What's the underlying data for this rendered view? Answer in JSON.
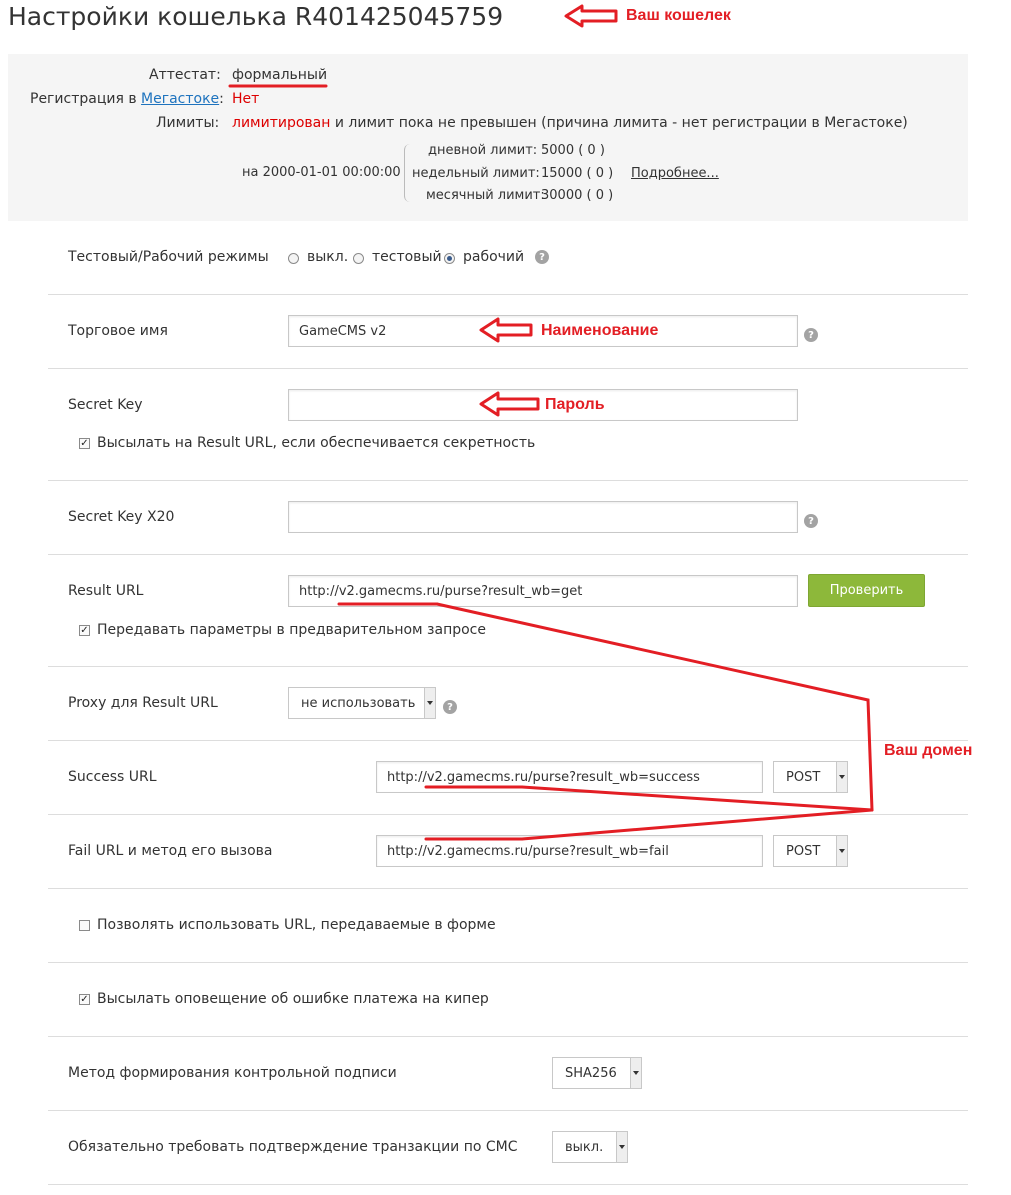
{
  "page_title": "Настройки кошелька R401425045759",
  "info": {
    "attestat_label": "Аттестат:",
    "attestat_value": "формальный",
    "registration_label": "Регистрация в",
    "registration_link": "Мегастоке",
    "registration_colon": ":",
    "registration_value": "Нет",
    "limits_label": "Лимиты:",
    "limits_status": "лимитирован",
    "limits_rest": " и лимит пока не превышен (причина лимита - нет регистрации в Мегастоке)",
    "date": "на 2000-01-01 00:00:00",
    "daily_label": "дневной лимит:",
    "daily_value": "5000 ( 0 )",
    "weekly_label": "недельный лимит:",
    "weekly_value": "15000 ( 0 )",
    "monthly_label": "месячный лимит:",
    "monthly_value": "30000 ( 0 )",
    "more_link": "Подробнее..."
  },
  "mode": {
    "label": "Тестовый/Рабочий режимы",
    "options": [
      "выкл.",
      "тестовый",
      "рабочий"
    ],
    "selected": "рабочий"
  },
  "trade_name": {
    "label": "Торговое имя",
    "value": "GameCMS v2"
  },
  "secret_key": {
    "label": "Secret Key",
    "value": "",
    "checkbox_label": "Высылать на Result URL, если обеспечивается секретность",
    "checked": true
  },
  "secret_key_x20": {
    "label": "Secret Key X20",
    "value": ""
  },
  "result_url": {
    "label": "Result URL",
    "value": "http://v2.gamecms.ru/purse?result_wb=get",
    "check_button": "Проверить",
    "checkbox_label": "Передавать параметры в предварительном запросе",
    "checked": true
  },
  "proxy": {
    "label": "Proxy для Result URL",
    "selected": "не использовать"
  },
  "success_url": {
    "label": "Success URL",
    "value": "http://v2.gamecms.ru/purse?result_wb=success",
    "method": "POST"
  },
  "fail_url": {
    "label": "Fail URL и метод его вызова",
    "value": "http://v2.gamecms.ru/purse?result_wb=fail",
    "method": "POST"
  },
  "allow_form_urls": {
    "label": "Позволять использовать URL, передаваемые в форме",
    "checked": false
  },
  "notify_error": {
    "label": "Высылать оповещение об ошибке платежа на кипер",
    "checked": true
  },
  "signature_method": {
    "label": "Метод формирования контрольной подписи",
    "selected": "SHA256"
  },
  "sms_confirm": {
    "label": "Обязательно требовать подтверждение транзакции по СМС",
    "selected": "выкл."
  },
  "help_glyph": "?",
  "check_glyph": "✓",
  "annotations": {
    "wallet": "Ваш кошелек",
    "name": "Наименование",
    "password": "Пароль",
    "domain": "Ваш домен",
    "color": "#e31e24"
  }
}
